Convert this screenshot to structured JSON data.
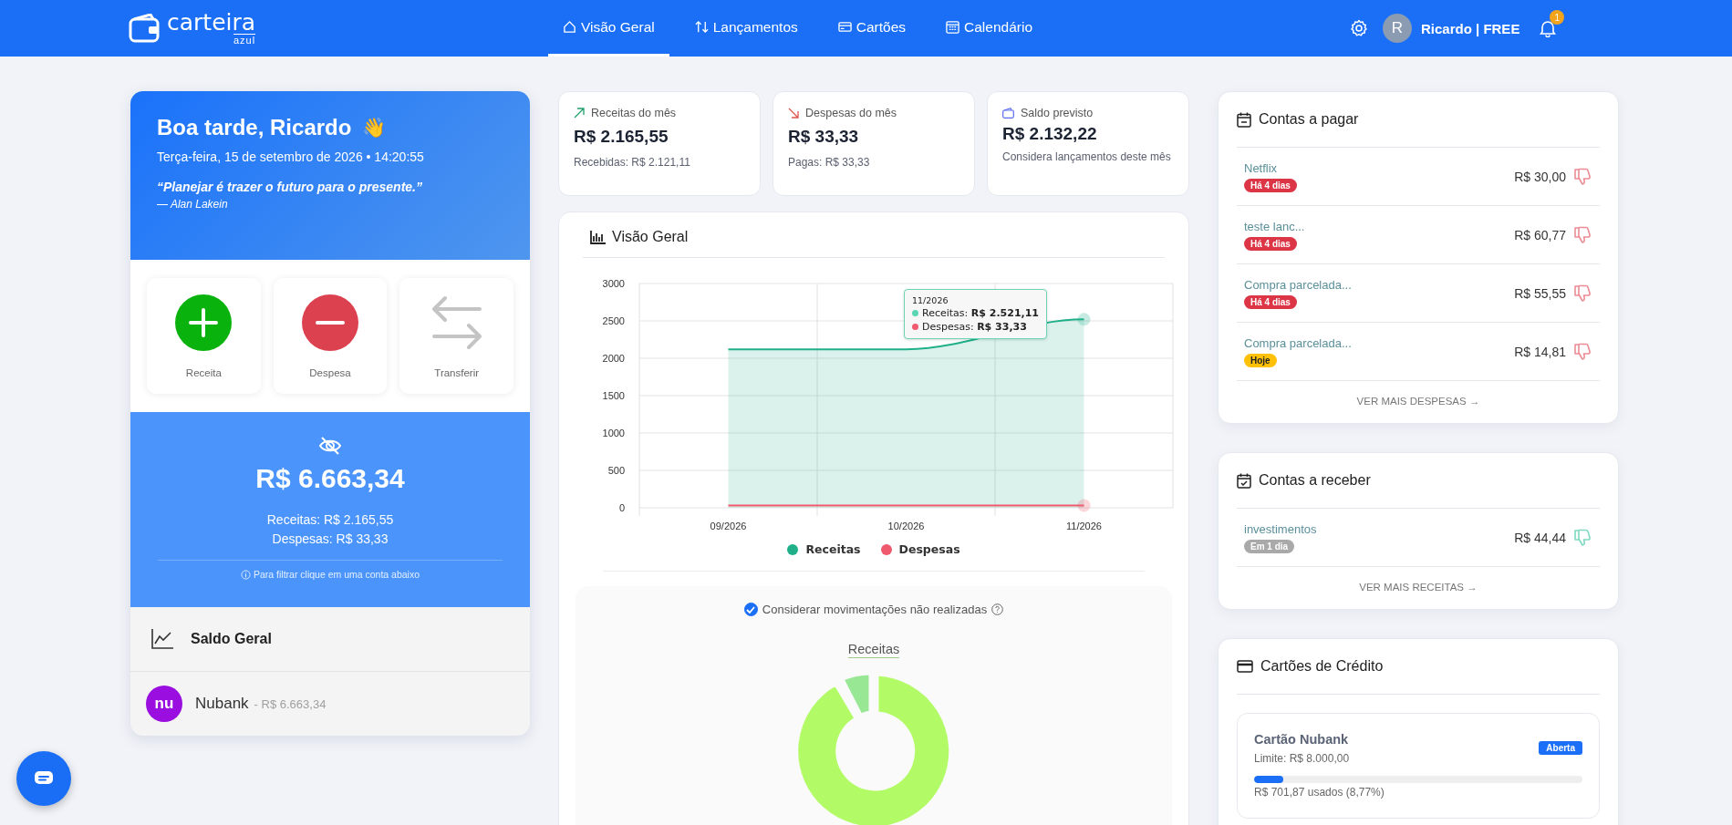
{
  "header": {
    "brand": {
      "name": "carteira",
      "sub": "azul"
    },
    "nav": [
      {
        "label": "Visão Geral",
        "selected": true
      },
      {
        "label": "Lançamentos",
        "selected": false
      },
      {
        "label": "Cartões",
        "selected": false
      },
      {
        "label": "Calendário",
        "selected": false
      }
    ],
    "user": {
      "initial": "R",
      "label": "Ricardo | FREE"
    },
    "notifications": "1"
  },
  "greeting": {
    "title": "Boa tarde, Ricardo",
    "emoji": "👋",
    "datetime": "Terça-feira, 15 de setembro de 2026 • 14:20:55",
    "quote": "“Planejar é trazer o futuro para o presente.”",
    "author": "— Alan Lakein"
  },
  "quick_actions": [
    {
      "label": "Receita",
      "kind": "income"
    },
    {
      "label": "Despesa",
      "kind": "expense"
    },
    {
      "label": "Transferir",
      "kind": "transfer"
    }
  ],
  "balance": {
    "total": "R$ 6.663,34",
    "income": "Receitas: R$ 2.165,55",
    "expenses": "Despesas: R$ 33,33",
    "hint": "Para filtrar clique em uma conta abaixo"
  },
  "accounts": {
    "title": "Saldo Geral",
    "items": [
      {
        "logo": "nu",
        "name": "Nubank",
        "balance": "- R$ 6.663,34"
      }
    ]
  },
  "stats": [
    {
      "kind": "up",
      "label": "Receitas do mês",
      "value": "R$ 2.165,55",
      "note": "Recebidas: R$ 2.121,11"
    },
    {
      "kind": "down",
      "label": "Despesas do mês",
      "value": "R$ 33,33",
      "note": "Pagas: R$ 33,33"
    },
    {
      "kind": "wallet",
      "label": "Saldo previsto",
      "value": "R$ 2.132,22",
      "note": "Considera lançamentos deste mês"
    }
  ],
  "overview": {
    "title": "Visão Geral",
    "chart_data": {
      "type": "area",
      "grid": true,
      "categories": [
        "09/2026",
        "10/2026",
        "11/2026"
      ],
      "ylim": [
        0,
        3000
      ],
      "yticks": [
        0,
        500,
        1000,
        1500,
        2000,
        2500,
        3000
      ],
      "series": [
        {
          "name": "Receitas",
          "color": "#1fb08a",
          "values": [
            2120,
            2120,
            2520
          ]
        },
        {
          "name": "Despesas",
          "type": "line",
          "color": "#f05a6e",
          "values": [
            30,
            30,
            30
          ]
        }
      ]
    },
    "tooltip": {
      "title": "11/2026",
      "rows": [
        {
          "label": "Receitas:",
          "value": "R$ 2.521,11",
          "color": "#5bd6b4"
        },
        {
          "label": "Despesas:",
          "value": "R$ 33,33",
          "color": "#f05a6e"
        }
      ]
    },
    "filter": {
      "label": "Considerar movimentações não realizadas",
      "checked": true
    },
    "donut_title": "Receitas"
  },
  "payables": {
    "title": "Contas a pagar",
    "items": [
      {
        "name": "Netflix",
        "badge": {
          "text": "Há 4 dias",
          "color": "#dc3545"
        },
        "amount": "R$ 30,00"
      },
      {
        "name": "teste lanc...",
        "badge": {
          "text": "Há 4 dias",
          "color": "#dc3545"
        },
        "amount": "R$ 60,77"
      },
      {
        "name": "Compra parcelada...",
        "badge": {
          "text": "Há 4 dias",
          "color": "#dc3545"
        },
        "amount": "R$ 55,55"
      },
      {
        "name": "Compra parcelada...",
        "badge": {
          "text": "Hoje",
          "color": "#ffc107"
        },
        "amount": "R$ 14,81"
      }
    ],
    "more": "VER MAIS DESPESAS →"
  },
  "receivables": {
    "title": "Contas a receber",
    "items": [
      {
        "name": "investimentos",
        "badge": {
          "text": "Em 1 dia",
          "color": "#a9a9a9"
        },
        "amount": "R$ 44,44"
      }
    ],
    "more": "VER MAIS RECEITAS →"
  },
  "credit_cards": {
    "title": "Cartões de Crédito",
    "items": [
      {
        "name": "Cartão Nubank",
        "limit": "Limite: R$ 8.000,00",
        "status": "Aberta",
        "level": 0.0877,
        "usage": "R$ 701,87 usados (8,77%)"
      }
    ]
  }
}
